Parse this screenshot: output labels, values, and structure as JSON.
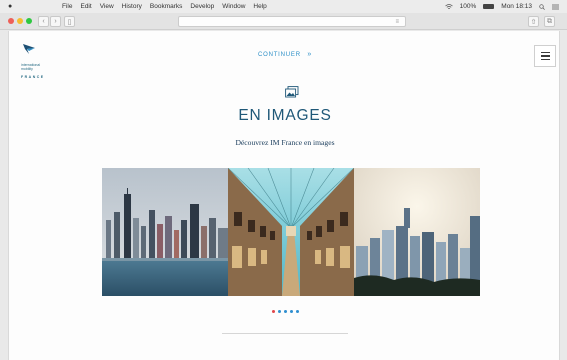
{
  "menubar": {
    "items": [
      "File",
      "Edit",
      "View",
      "History",
      "Bookmarks",
      "Develop",
      "Window",
      "Help"
    ],
    "battery": "100%",
    "clock": "Mon 18:13"
  },
  "header": {
    "continuer_label": "CONTINUER",
    "continuer_arrow": "»"
  },
  "logo": {
    "line1": "international",
    "line2": "mobility",
    "line3": "FRANCE"
  },
  "section": {
    "title": "EN IMAGES",
    "subtitle": "Découvrez IM France en images"
  },
  "colors": {
    "accent": "#1f5878",
    "link": "#2c8fc7",
    "dot_red": "#e0474c",
    "dot_blue": "#2f8fd0"
  },
  "icons": [
    "apple-icon",
    "wifi-icon",
    "battery-icon",
    "search-icon",
    "list-icon",
    "back-icon",
    "forward-icon",
    "sidebar-icon",
    "reader-icon",
    "share-icon",
    "tabs-icon",
    "menu-icon",
    "photo-gallery-icon"
  ],
  "carousel": {
    "images": [
      "chicago-skyline-photo",
      "gallery-arcade-photo",
      "skyscrapers-sky-photo"
    ],
    "dots": 5,
    "active_index": 0
  }
}
